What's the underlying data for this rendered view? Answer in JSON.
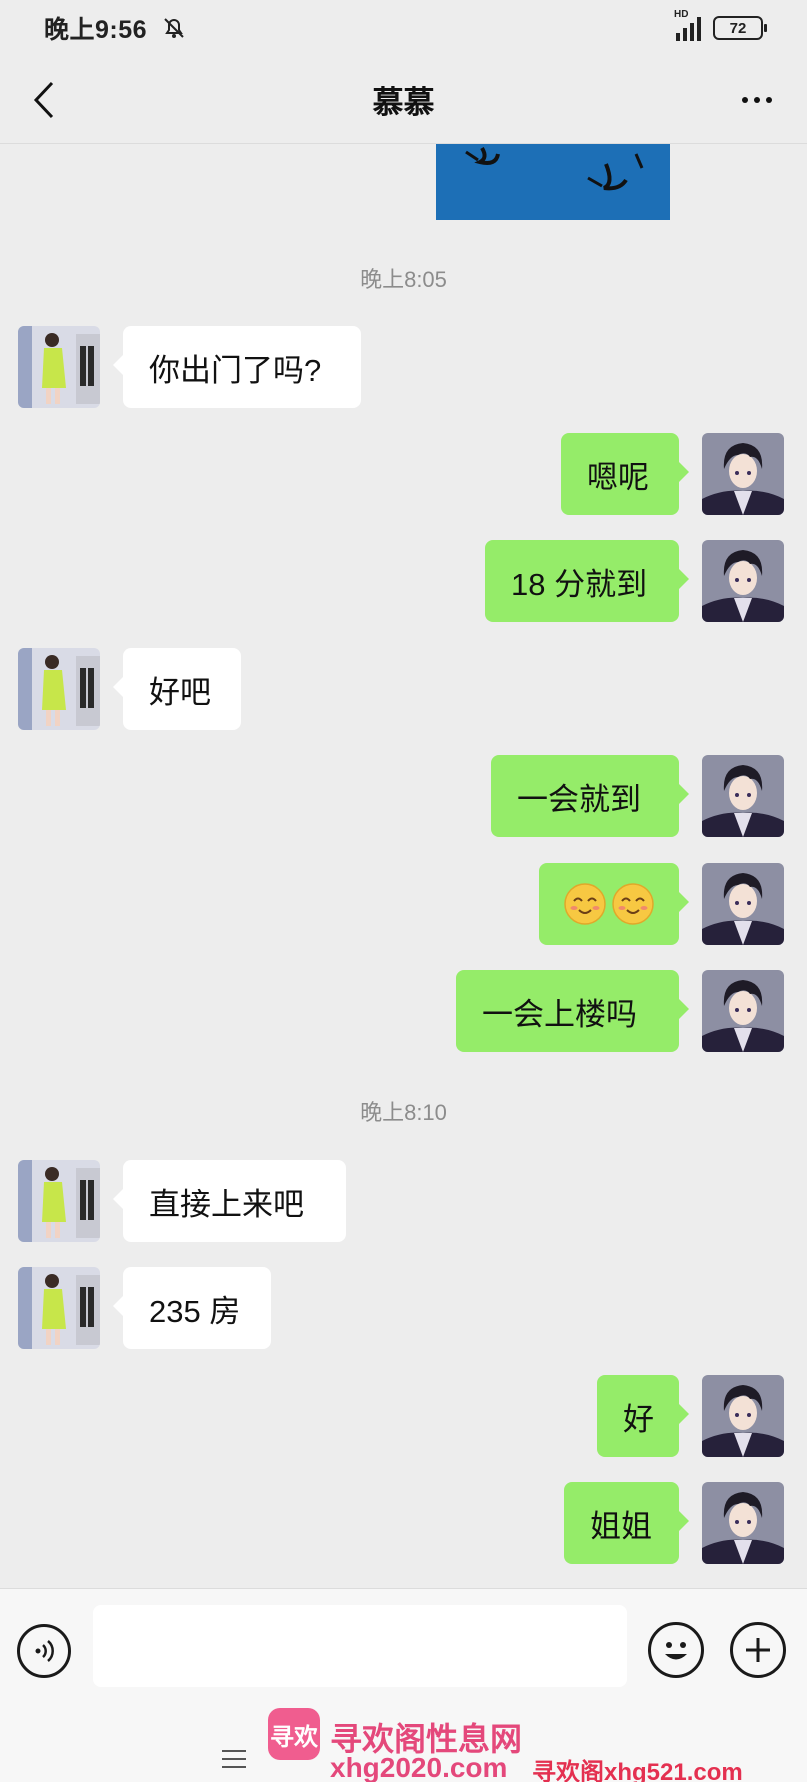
{
  "status_bar": {
    "time": "晚上9:56",
    "network_label": "HD",
    "battery": "72"
  },
  "nav": {
    "title": "慕慕"
  },
  "messages": [
    {
      "type": "timestamp",
      "text": "晚上8:05"
    },
    {
      "side": "left",
      "text": "你出门了吗?"
    },
    {
      "side": "right",
      "text": "嗯呢"
    },
    {
      "side": "right",
      "text": "18 分就到"
    },
    {
      "side": "left",
      "text": "好吧"
    },
    {
      "side": "right",
      "text": "一会就到"
    },
    {
      "side": "right",
      "text": "",
      "emojis": [
        "smiling-face-icon",
        "smiling-face-icon"
      ]
    },
    {
      "side": "right",
      "text": "一会上楼吗"
    },
    {
      "type": "timestamp",
      "text": "晚上8:10"
    },
    {
      "side": "left",
      "text": "直接上来吧"
    },
    {
      "side": "left",
      "text": "235 房"
    },
    {
      "side": "right",
      "text": "好"
    },
    {
      "side": "right",
      "text": "姐姐"
    }
  ],
  "input": {
    "placeholder": ""
  },
  "watermark": {
    "logo": "寻欢",
    "title": "寻欢阁性息网",
    "url1": "xhg2020.com",
    "url2": "寻欢阁xhg521.com"
  },
  "colors": {
    "background": "#ededed",
    "outgoing_bubble": "#95ec69",
    "incoming_bubble": "#ffffff",
    "watermark": "#e4487b"
  }
}
